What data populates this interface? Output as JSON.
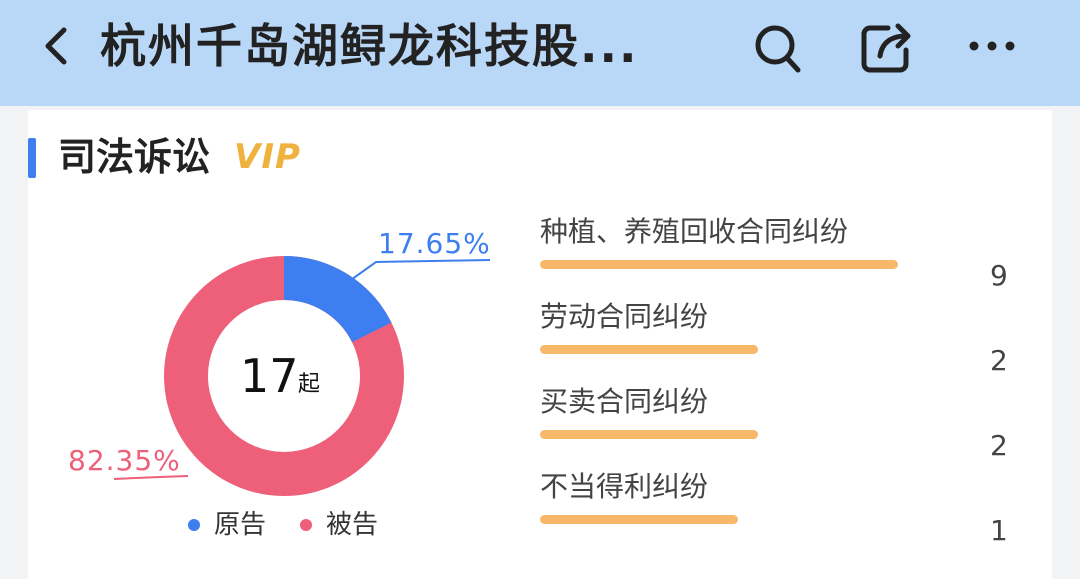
{
  "header": {
    "title": "杭州千岛湖鲟龙科技股...",
    "icons": [
      "back-icon",
      "search-icon",
      "share-icon",
      "more-icon"
    ],
    "bg_color": "#b9d7f7"
  },
  "section": {
    "title": "司法诉讼",
    "badge": "VIP",
    "accent_color": "#3d7ff0"
  },
  "donut": {
    "total": "17",
    "unit": "起",
    "plaintiff_pct_label": "17.65%",
    "defendant_pct_label": "82.35%",
    "plaintiff_fraction": 0.1765,
    "plaintiff_color": "#3d7ff0",
    "defendant_color": "#ee607a"
  },
  "legend": {
    "plaintiff": "原告",
    "defendant": "被告"
  },
  "cases": [
    {
      "name": "种植、养殖回收合同纠纷",
      "count": "9",
      "value": 9
    },
    {
      "name": "劳动合同纠纷",
      "count": "2",
      "value": 2
    },
    {
      "name": "买卖合同纠纷",
      "count": "2",
      "value": 2
    },
    {
      "name": "不当得利纠纷",
      "count": "1",
      "value": 1
    }
  ],
  "bar_color": "#f7b86a"
}
